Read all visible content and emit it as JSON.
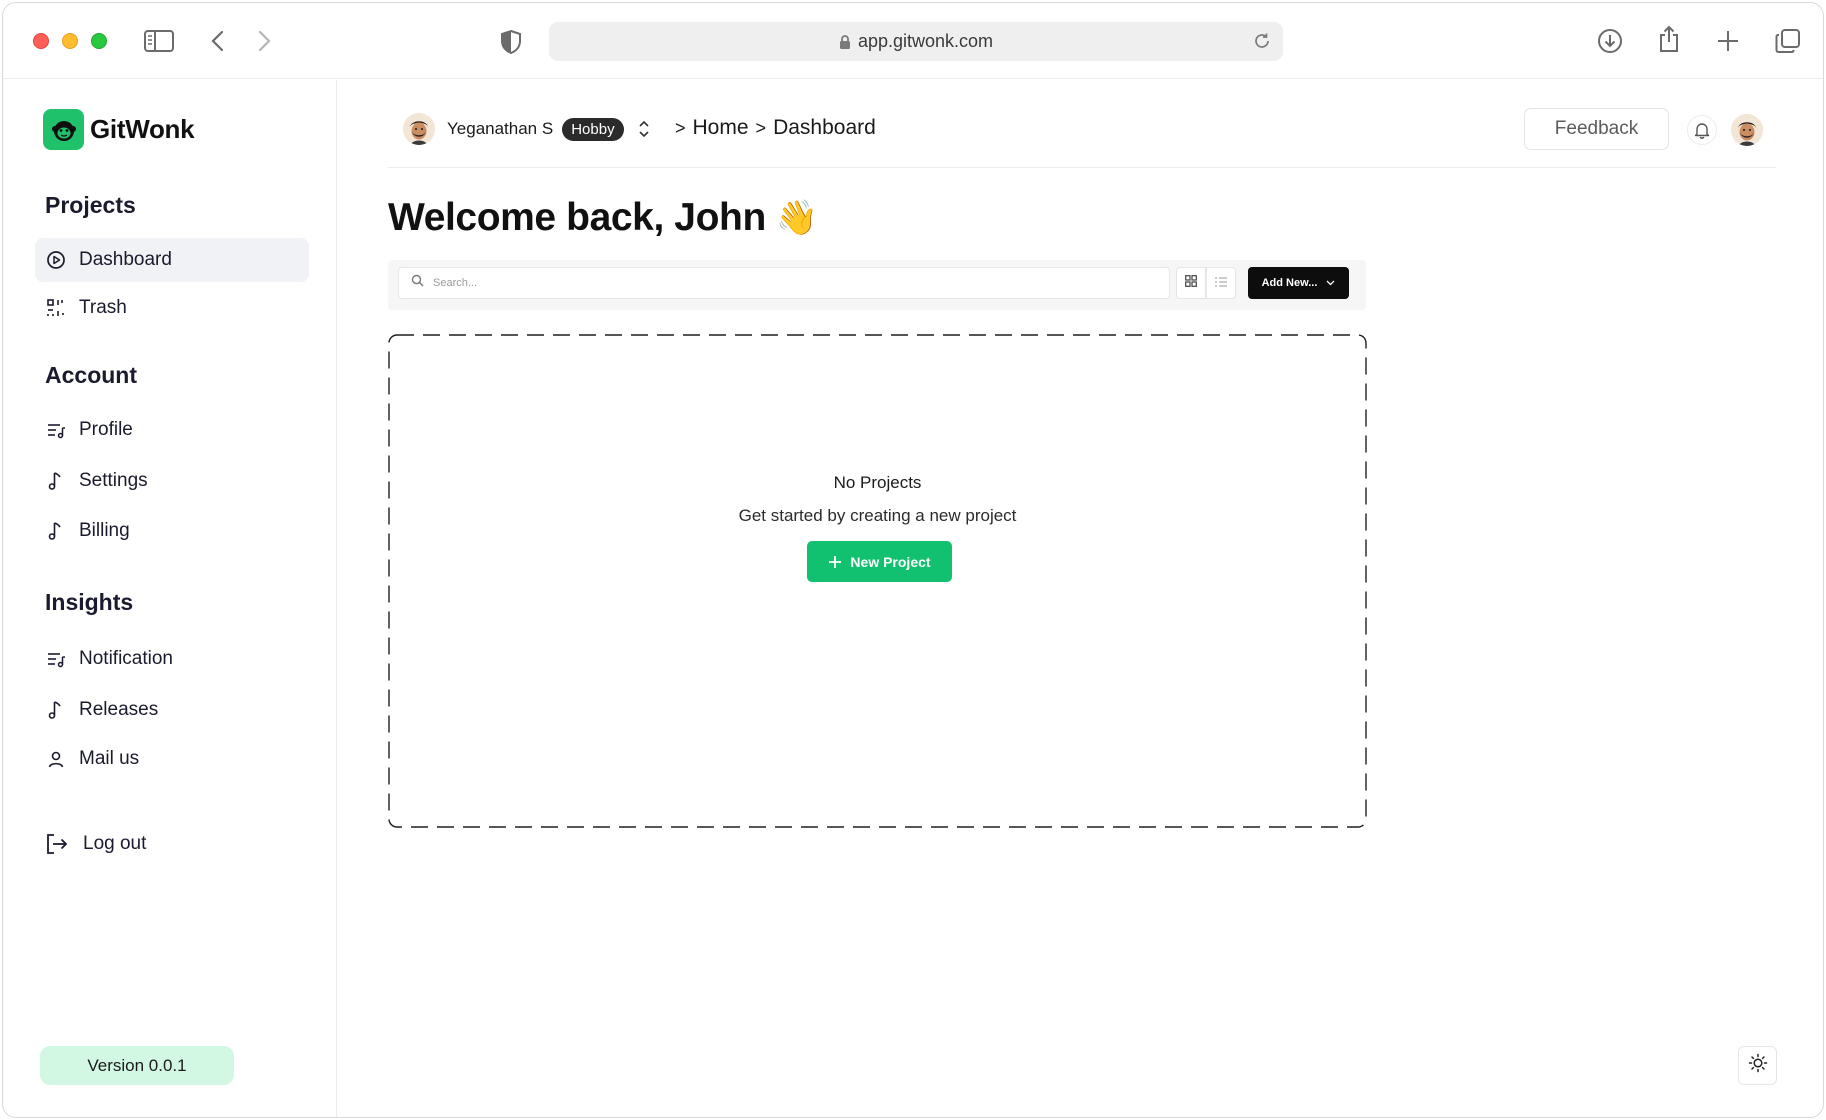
{
  "browser": {
    "url": "app.gitwonk.com"
  },
  "sidebar": {
    "brand": "GitWonk",
    "sections": [
      {
        "title": "Projects",
        "items": [
          {
            "label": "Dashboard",
            "icon": "play-circle-icon",
            "active": true
          },
          {
            "label": "Trash",
            "icon": "scan-icon"
          }
        ]
      },
      {
        "title": "Account",
        "items": [
          {
            "label": "Profile",
            "icon": "list-music-icon"
          },
          {
            "label": "Settings",
            "icon": "music-note-icon"
          },
          {
            "label": "Billing",
            "icon": "music-note-icon"
          }
        ]
      },
      {
        "title": "Insights",
        "items": [
          {
            "label": "Notification",
            "icon": "list-music-icon"
          },
          {
            "label": "Releases",
            "icon": "music-note-icon"
          },
          {
            "label": "Mail us",
            "icon": "user-icon"
          }
        ]
      }
    ],
    "logout": "Log out",
    "version": "Version 0.0.1"
  },
  "header": {
    "user_name": "Yeganathan S",
    "plan": "Hobby",
    "breadcrumb": [
      "Home",
      "Dashboard"
    ],
    "breadcrumb_sep": ">",
    "feedback": "Feedback"
  },
  "main": {
    "welcome": "Welcome back, John",
    "wave": "👋",
    "search_placeholder": "Search...",
    "add_new": "Add New...",
    "empty_title": "No Projects",
    "empty_subtitle": "Get started by creating a new project",
    "new_project": "New Project"
  },
  "colors": {
    "brand_green": "#1fc16b",
    "button_green": "#12c16f",
    "version_bg": "#d2f8e4"
  }
}
